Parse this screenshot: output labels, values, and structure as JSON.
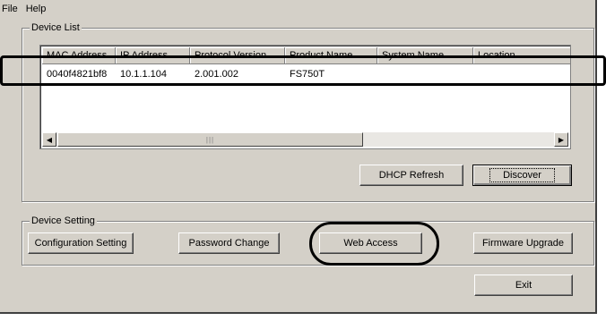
{
  "menu": [
    "File",
    "Help"
  ],
  "device_list": {
    "title": "Device List",
    "columns": [
      "MAC Address",
      "IP Address",
      "Protocol Version",
      "Product Name",
      "System Name",
      "Location"
    ],
    "rows": [
      [
        "0040f4821bf8",
        "10.1.1.104",
        "2.001.002",
        "FS750T",
        "",
        ""
      ]
    ],
    "scroll_left_icon": "◀",
    "scroll_right_icon": "▶",
    "scroll_thumb_grip": "|||"
  },
  "buttons": {
    "dhcp_refresh": "DHCP Refresh",
    "discover": "Discover",
    "configuration_setting": "Configuration Setting",
    "password_change": "Password Change",
    "web_access": "Web Access",
    "firmware_upgrade": "Firmware Upgrade",
    "exit": "Exit"
  },
  "device_setting": {
    "title": "Device Setting"
  }
}
